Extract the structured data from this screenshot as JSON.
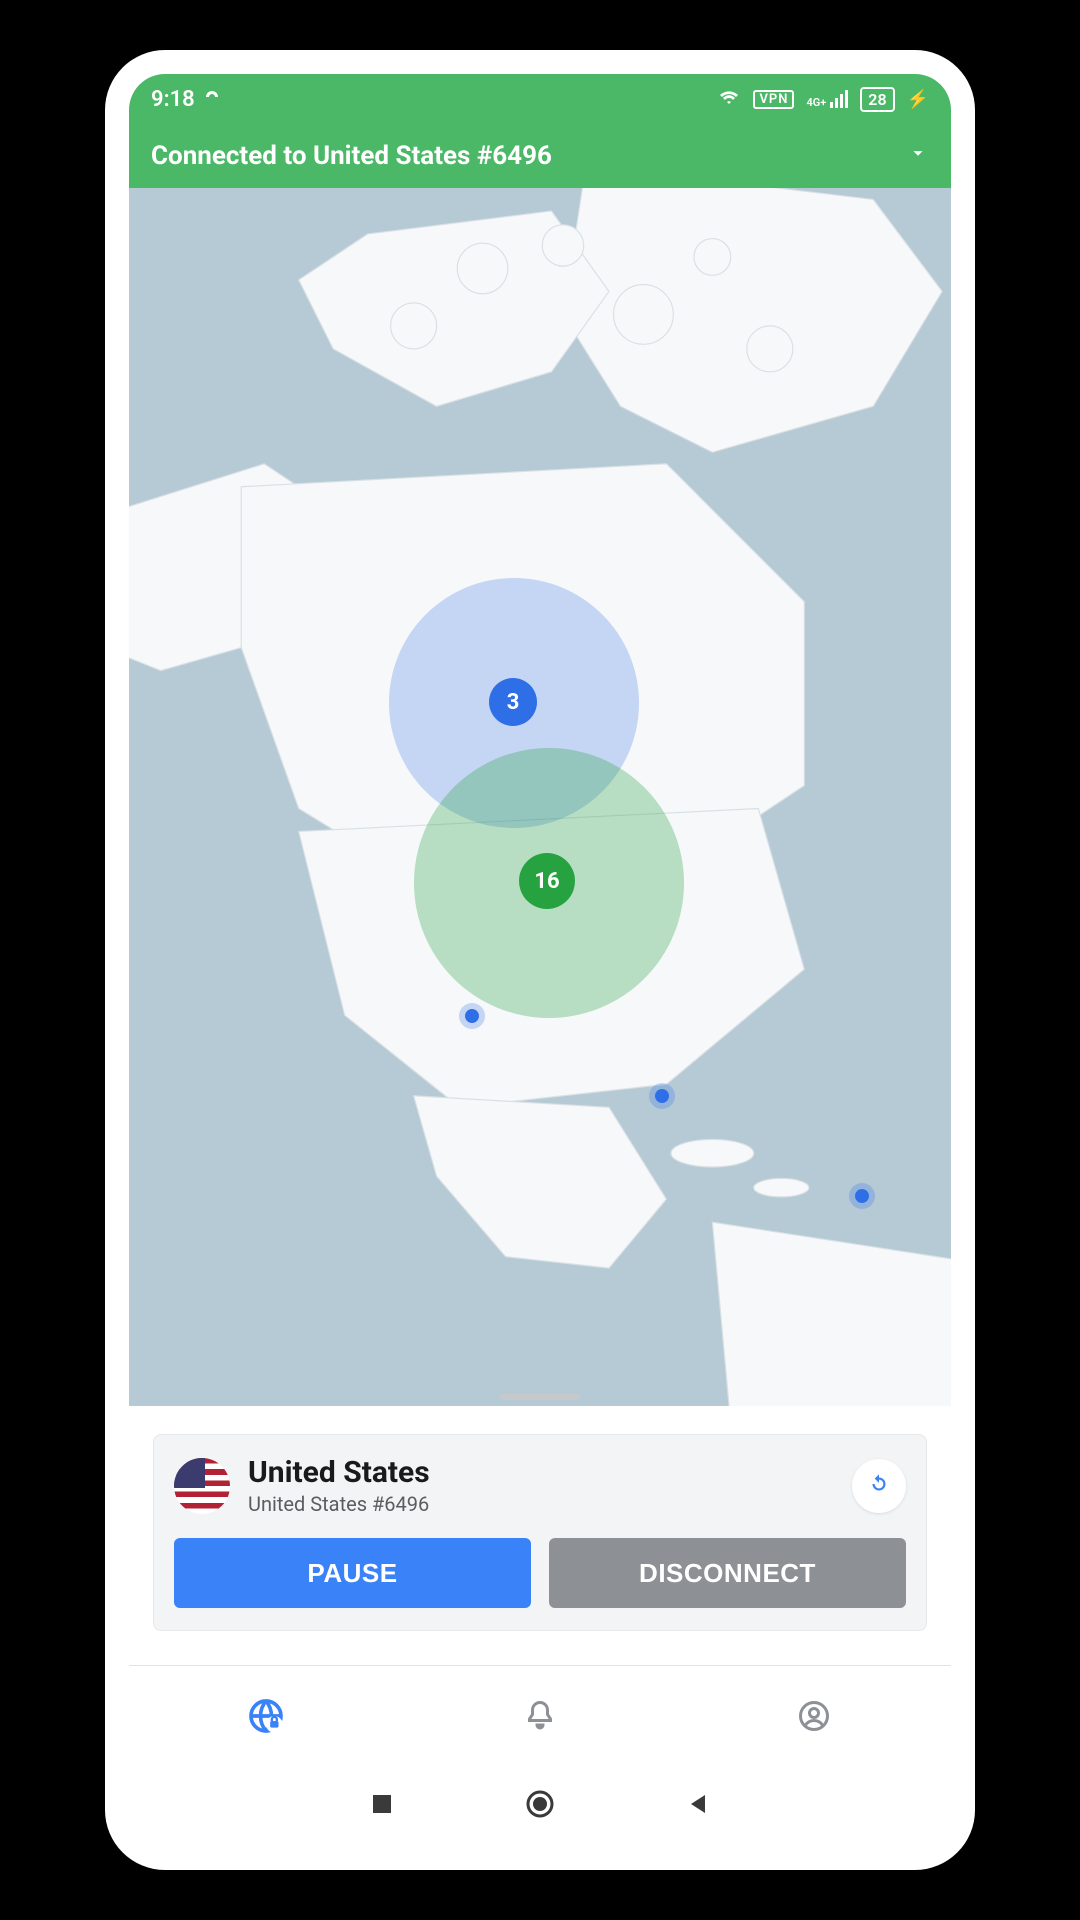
{
  "status_bar": {
    "time": "9:18",
    "vpn_label": "VPN",
    "signal_label": "4G+",
    "battery_percent": "28"
  },
  "banner": {
    "text": "Connected to United States #6496"
  },
  "map": {
    "clusters": [
      {
        "label": "3",
        "color": "blue"
      },
      {
        "label": "16",
        "color": "green"
      }
    ]
  },
  "card": {
    "country": "United States",
    "server": "United States #6496",
    "pause_label": "PAUSE",
    "disconnect_label": "DISCONNECT"
  },
  "colors": {
    "accent_green": "#4ab866",
    "accent_blue": "#3a82f7",
    "cluster_blue": "#2e6ee6",
    "cluster_green": "#26a241"
  }
}
